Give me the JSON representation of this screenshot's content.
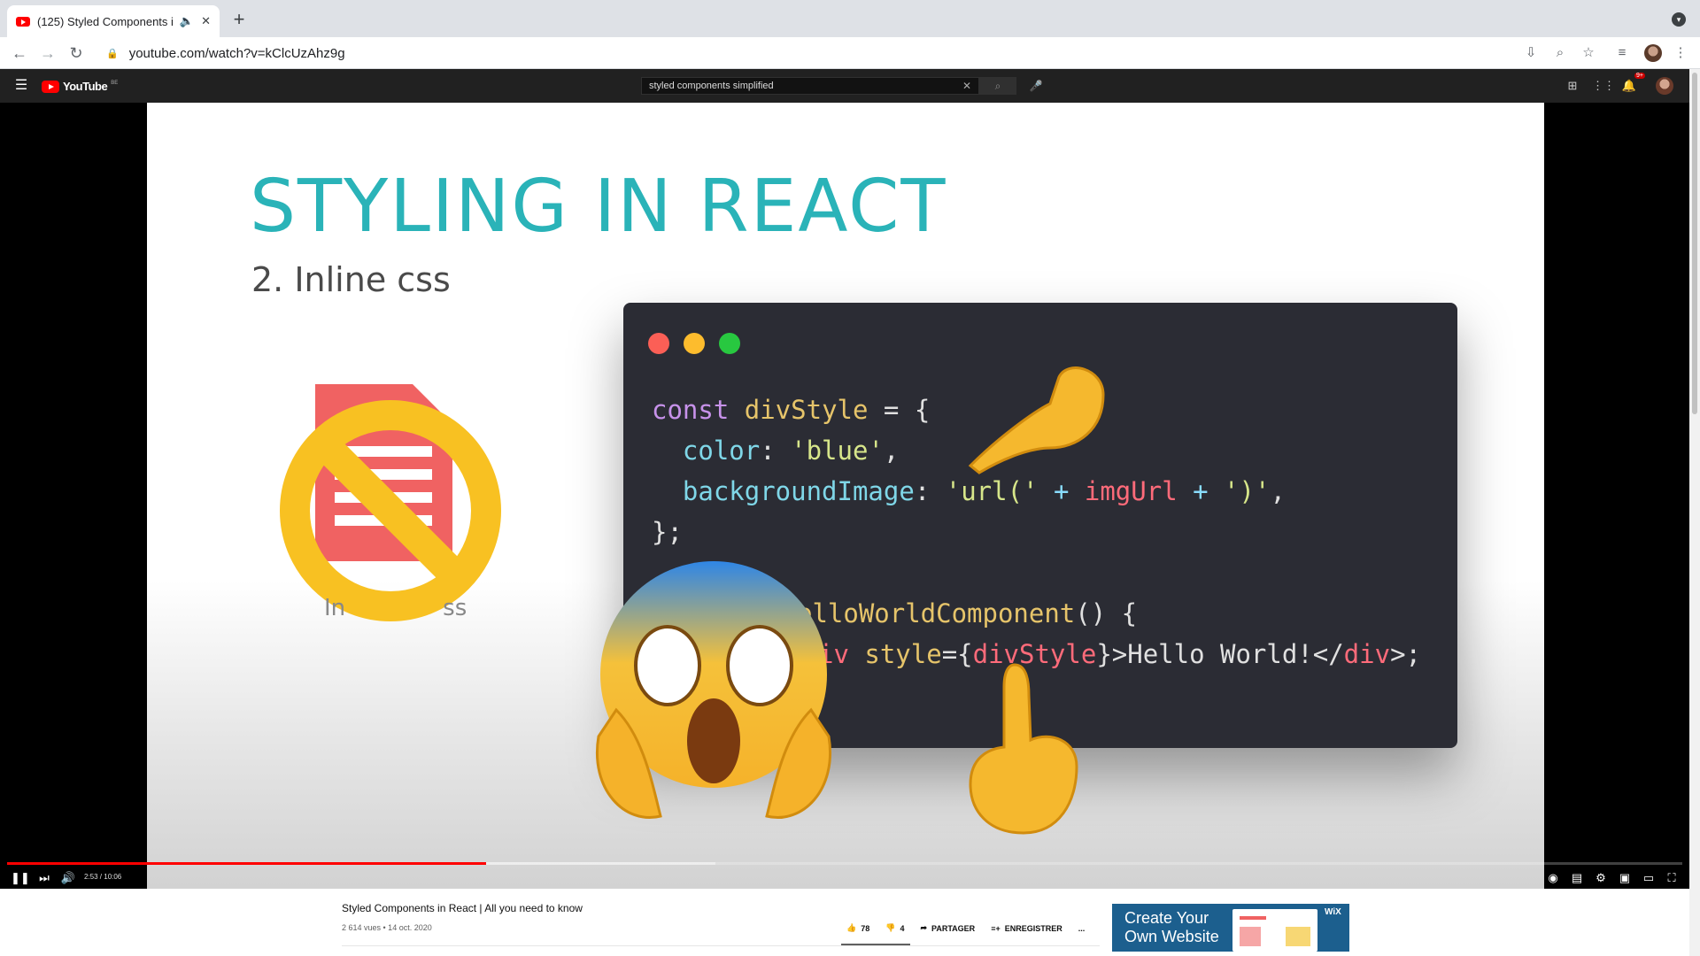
{
  "browser": {
    "tab_title": "(125) Styled Components i",
    "url": "youtube.com/watch?v=kClcUzAhz9g"
  },
  "youtube": {
    "logo_text": "YouTube",
    "logo_country": "BE",
    "search_value": "styled components simplified",
    "notif_count": "9+"
  },
  "slide": {
    "title": "STYLING IN REACT",
    "subtitle": "2. Inline css",
    "doc_label_left": "In",
    "doc_label_right": "ss",
    "code": {
      "l1_kw": "const",
      "l1_id": "divStyle",
      "l1_rest": " = {",
      "l2_prop": "  color",
      "l2_rest": ": ",
      "l2_val": "'blue'",
      "l2_end": ",",
      "l3_prop": "  backgroundImage",
      "l3_rest": ": ",
      "l3_s1": "'url('",
      "l3_op1": " + ",
      "l3_var": "imgUrl",
      "l3_op2": " + ",
      "l3_s2": "')'",
      "l3_end": ",",
      "l4": "};",
      "l6_fn": "elloWorldComponent",
      "l6_rest": "() {",
      "l7_a": "iv ",
      "l7_attr": "style",
      "l7_b": "={",
      "l7_var": "divStyle",
      "l7_c": "}>Hello World!</",
      "l7_tag": "div",
      "l7_d": ">;"
    }
  },
  "player": {
    "time": "2:53 / 10:06",
    "progress": 0.286
  },
  "video": {
    "title": "Styled Components in React | All you need to know",
    "meta": "2 614 vues • 14 oct. 2020",
    "likes": "78",
    "dislikes": "4",
    "share": "PARTAGER",
    "save": "ENREGISTRER",
    "more": "..."
  },
  "ad": {
    "text": "Create Your Own Website",
    "brand": "WiX"
  }
}
